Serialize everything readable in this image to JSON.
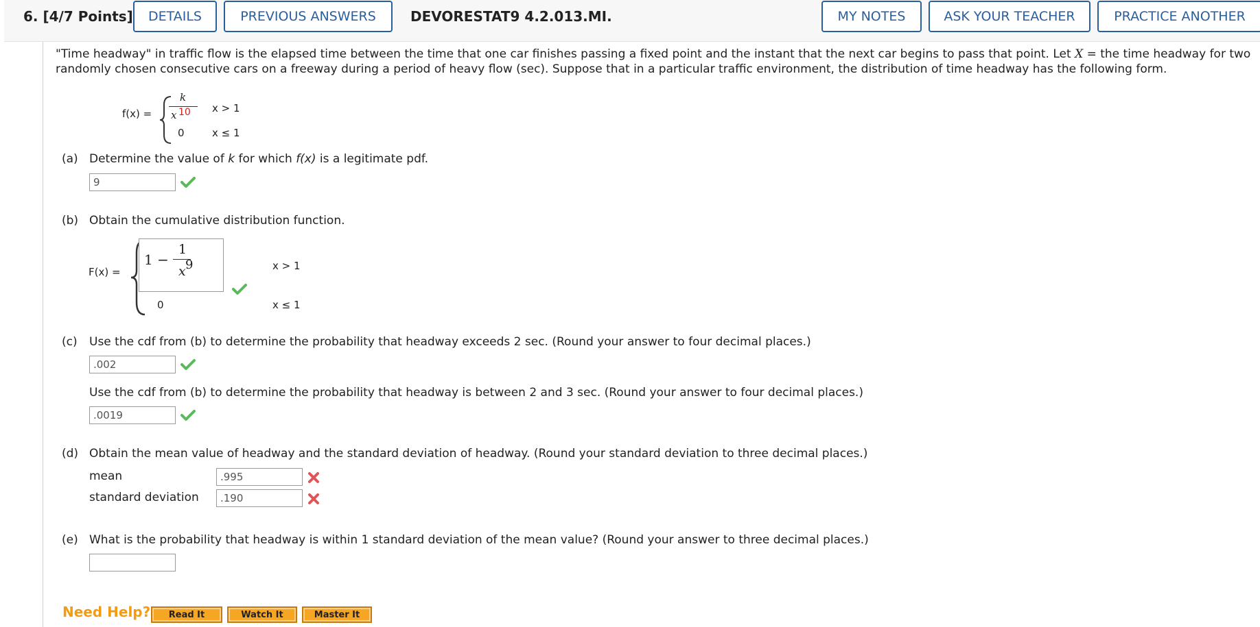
{
  "header": {
    "question_label": "6. [4/7 Points]",
    "details": "DETAILS",
    "previous_answers": "PREVIOUS ANSWERS",
    "code": "DEVORESTAT9 4.2.013.MI.",
    "my_notes": "MY NOTES",
    "ask_teacher": "ASK YOUR TEACHER",
    "practice_another": "PRACTICE ANOTHER"
  },
  "intro": {
    "line1_a": "\"Time headway\" in traffic flow is the elapsed time between the time that one car finishes passing a fixed point and the instant that the next car begins to pass that point. Let ",
    "line1_var": "X",
    "line1_b": " = the time headway for two",
    "line2": "randomly chosen consecutive cars on a freeway during a period of heavy flow (sec). Suppose that in a particular traffic environment, the distribution of time headway has the following form."
  },
  "pdf": {
    "lhs": "f(x) =",
    "k": "k",
    "x": "x",
    "exp": "10",
    "zero": "0",
    "cond1": "x > 1",
    "cond2": "x ≤ 1"
  },
  "part_a": {
    "label": "(a)",
    "text_1": "Determine the value of ",
    "text_k": "k",
    "text_2": " for which ",
    "text_fx": "f(x)",
    "text_3": " is a legitimate pdf.",
    "answer": "9",
    "status": "correct"
  },
  "part_b": {
    "label": "(b)",
    "text": "Obtain the cumulative distribution function.",
    "lhs": "F(x) =",
    "one_minus": "1 −",
    "num": "1",
    "den_x": "x",
    "den_exp": "9",
    "zero": "0",
    "cond1": "x > 1",
    "cond2": "x ≤ 1",
    "status": "correct"
  },
  "part_c": {
    "label": "(c)",
    "text1": "Use the cdf from (b) to determine the probability that headway exceeds 2 sec. (Round your answer to four decimal places.)",
    "answer1": ".002",
    "text2": "Use the cdf from (b) to determine the probability that headway is between 2 and 3 sec. (Round your answer to four decimal places.)",
    "answer2": ".0019"
  },
  "part_d": {
    "label": "(d)",
    "text": "Obtain the mean value of headway and the standard deviation of headway. (Round your standard deviation to three decimal places.)",
    "mean_label": "mean",
    "mean_value": ".995",
    "sd_label": "standard deviation",
    "sd_value": ".190"
  },
  "part_e": {
    "label": "(e)",
    "text": "What is the probability that headway is within 1 standard deviation of the mean value? (Round your answer to three decimal places.)",
    "answer": ""
  },
  "help": {
    "label": "Need Help?",
    "read_it": "Read It",
    "watch_it": "Watch It",
    "master_it": "Master It"
  },
  "colors": {
    "accent": "#2a5f9e",
    "correct": "#5cb85c",
    "incorrect": "#e05555",
    "help_orange": "#f6a623",
    "exponent_red": "#cc2222"
  }
}
